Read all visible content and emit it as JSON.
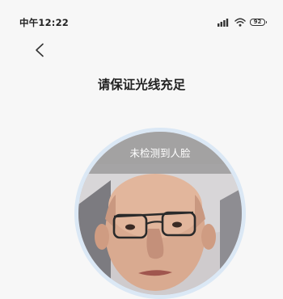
{
  "status_bar": {
    "time": "中午12:22",
    "battery": "92",
    "signal_icon": "signal-bars-icon",
    "wifi_icon": "wifi-icon"
  },
  "nav": {
    "back_icon": "chevron-left-icon"
  },
  "title": "请保证光线充足",
  "camera": {
    "status_text": "未检测到人脸"
  },
  "colors": {
    "background": "#f7f7f7",
    "ring": "#dbe8f5",
    "banner": "#969696"
  }
}
